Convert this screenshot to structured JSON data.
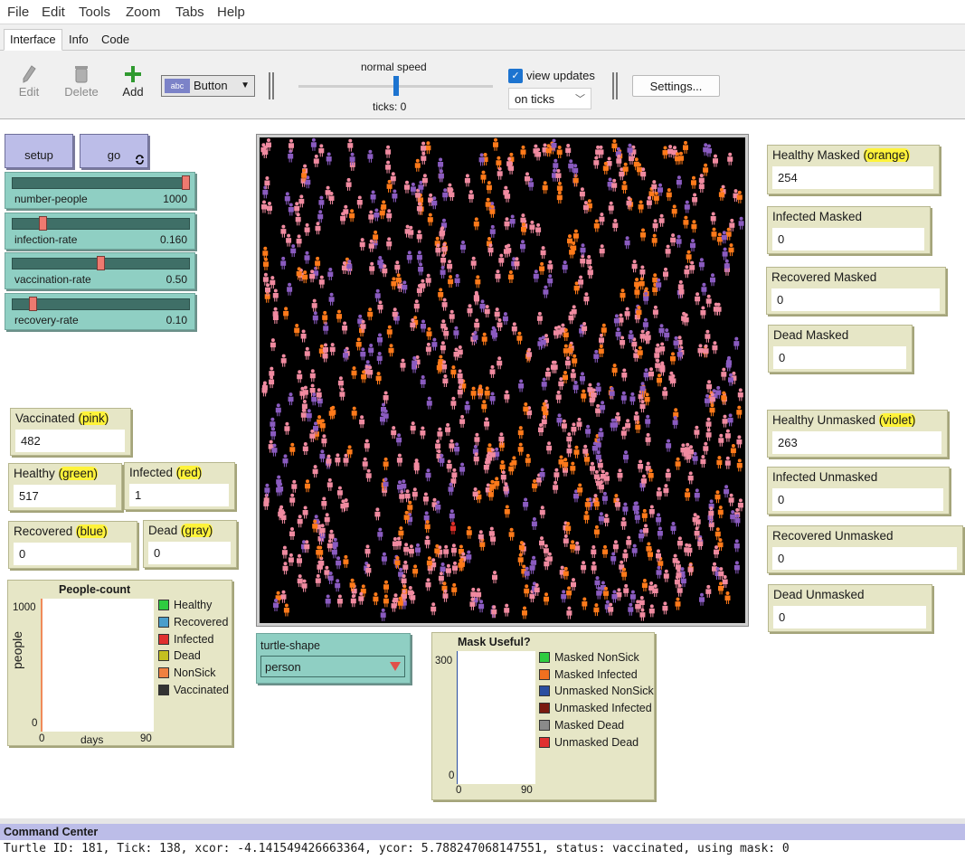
{
  "menu": [
    "File",
    "Edit",
    "Tools",
    "Zoom",
    "Tabs",
    "Help"
  ],
  "tabs": [
    "Interface",
    "Info",
    "Code"
  ],
  "toolbar": {
    "edit": "Edit",
    "delete": "Delete",
    "add": "Add",
    "widget_type": "Button",
    "speed_label": "normal speed",
    "speed_fraction": 0.5,
    "ticks": "ticks: 0",
    "view_updates": "view updates",
    "update_mode": "on ticks",
    "settings": "Settings..."
  },
  "buttons": {
    "setup": "setup",
    "go": "go"
  },
  "sliders": [
    {
      "name": "number-people",
      "value": "1000",
      "fraction": 1.0
    },
    {
      "name": "infection-rate",
      "value": "0.160",
      "fraction": 0.16
    },
    {
      "name": "vaccination-rate",
      "value": "0.50",
      "fraction": 0.5
    },
    {
      "name": "recovery-rate",
      "value": "0.10",
      "fraction": 0.1
    }
  ],
  "monitors_left": {
    "vaccinated": {
      "label": "Vaccinated ",
      "hl": "(pink)",
      "value": "482"
    },
    "healthy": {
      "label": "Healthy ",
      "hl": "(green)",
      "value": "517"
    },
    "infected": {
      "label": "Infected ",
      "hl": "(red)",
      "value": "1"
    },
    "recovered": {
      "label": "Recovered ",
      "hl": "(blue)",
      "value": "0"
    },
    "dead": {
      "label": "Dead ",
      "hl": "(gray)",
      "value": "0"
    }
  },
  "monitors_right": {
    "healthy_masked": {
      "label": "Healthy Masked ",
      "hl": "(orange)",
      "value": "254"
    },
    "infected_masked": {
      "label": "Infected Masked",
      "value": "0"
    },
    "recovered_masked": {
      "label": "Recovered Masked",
      "value": "0"
    },
    "dead_masked": {
      "label": "Dead Masked",
      "value": "0"
    },
    "healthy_unmasked": {
      "label": "Healthy Unmasked ",
      "hl": "(violet)",
      "value": "263"
    },
    "infected_unmasked": {
      "label": "Infected Unmasked",
      "value": "0"
    },
    "recovered_unmasked": {
      "label": "Recovered Unmasked",
      "value": "0"
    },
    "dead_unmasked": {
      "label": "Dead Unmasked",
      "value": "0"
    }
  },
  "chooser": {
    "label": "turtle-shape",
    "value": "person"
  },
  "people_plot": {
    "title": "People-count",
    "ylabel": "people",
    "xlabel": "days",
    "ymax": "1000",
    "ymin": "0",
    "xmin": "0",
    "xmax": "90",
    "legend": [
      {
        "name": "Healthy",
        "color": "#2ecc40"
      },
      {
        "name": "Recovered",
        "color": "#4a9ecb"
      },
      {
        "name": "Infected",
        "color": "#e03030"
      },
      {
        "name": "Dead",
        "color": "#c4c020"
      },
      {
        "name": "NonSick",
        "color": "#f08040"
      },
      {
        "name": "Vaccinated",
        "color": "#333333"
      }
    ]
  },
  "mask_plot": {
    "title": "Mask Useful?",
    "ymax": "300",
    "ymin": "0",
    "xmin": "0",
    "xmax": "90",
    "legend": [
      {
        "name": "Masked NonSick",
        "color": "#2ecc40"
      },
      {
        "name": "Masked Infected",
        "color": "#f07020"
      },
      {
        "name": "Unmasked NonSick",
        "color": "#2a4ea0"
      },
      {
        "name": "Unmasked Infected",
        "color": "#7a1a10"
      },
      {
        "name": "Masked Dead",
        "color": "#8a8a8a"
      },
      {
        "name": "Unmasked Dead",
        "color": "#e03030"
      }
    ]
  },
  "agent_colors": {
    "orange": "#ff7a1a",
    "pink": "#f08aa0",
    "violet": "#8a5bc0",
    "red": "#e0302a"
  },
  "command_center": {
    "title": "Command Center",
    "output": "Turtle ID: 181, Tick: 138, xcor: -4.141549426663364, ycor: 5.788247068147551, status: vaccinated, using mask: 0"
  }
}
